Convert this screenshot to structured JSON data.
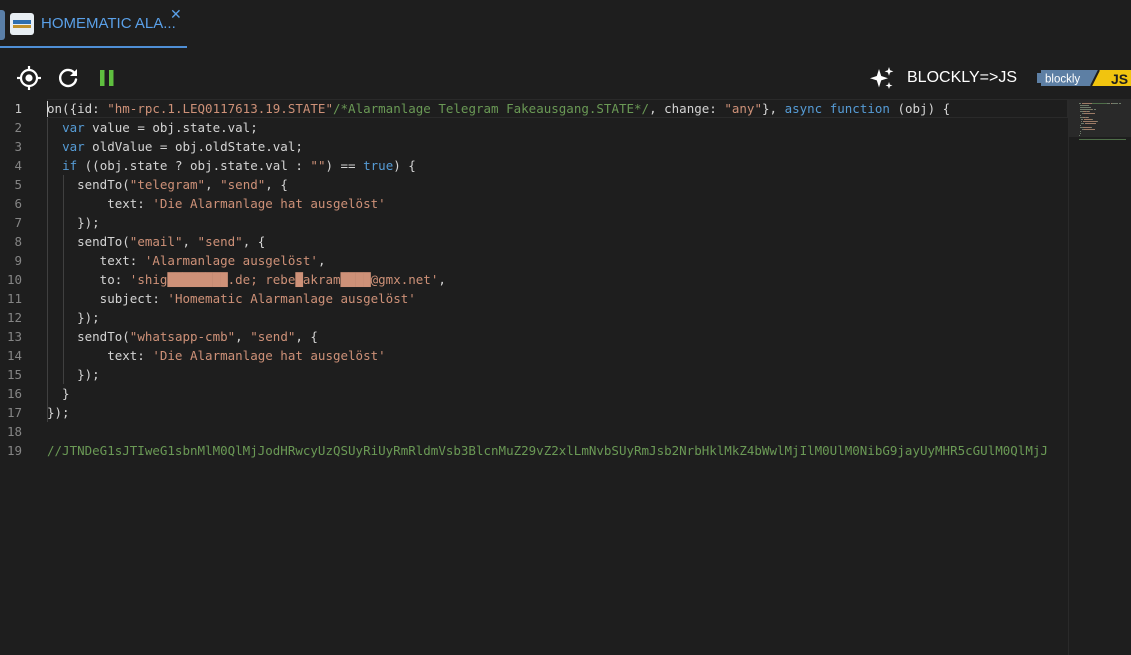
{
  "tab": {
    "label": "HOMEMATIC ALA...",
    "close_glyph": "✕",
    "icon": "homematic-script-icon"
  },
  "toolbar": {
    "locate_icon": "crosshair-icon",
    "reload_icon": "reload-icon",
    "pause_icon": "pause-icon",
    "convert_icon": "sparkle-icon",
    "convert_label": "BLOCKLY=>JS",
    "logo_blockly_text": "blockly",
    "logo_js_text": "JS"
  },
  "colors": {
    "keyword": "#569cd6",
    "string": "#ce9178",
    "comment": "#6a9955",
    "accent": "#4f8fd6",
    "pause": "#5fbf3f"
  },
  "editor": {
    "active_line": 1,
    "line_numbers": [
      "1",
      "2",
      "3",
      "4",
      "5",
      "6",
      "7",
      "8",
      "9",
      "10",
      "11",
      "12",
      "13",
      "14",
      "15",
      "16",
      "17",
      "18",
      "19"
    ],
    "lines": [
      [
        [
          "pl",
          "on({id: "
        ],
        [
          "str",
          "\"hm-rpc.1.LEQ0117613.19.STATE\""
        ],
        [
          "cm",
          "/*Alarmanlage Telegram Fakeausgang.STATE*/"
        ],
        [
          "pl",
          ", change: "
        ],
        [
          "str",
          "\"any\""
        ],
        [
          "pl",
          "}, "
        ],
        [
          "kw",
          "async"
        ],
        [
          "pl",
          " "
        ],
        [
          "kw",
          "function"
        ],
        [
          "pl",
          " (obj) {"
        ]
      ],
      [
        [
          "pl",
          "  "
        ],
        [
          "kw",
          "var"
        ],
        [
          "pl",
          " value = obj.state.val;"
        ]
      ],
      [
        [
          "pl",
          "  "
        ],
        [
          "kw",
          "var"
        ],
        [
          "pl",
          " oldValue = obj.oldState.val;"
        ]
      ],
      [
        [
          "pl",
          "  "
        ],
        [
          "kw",
          "if"
        ],
        [
          "pl",
          " ((obj.state ? obj.state.val : "
        ],
        [
          "str",
          "\"\""
        ],
        [
          "pl",
          ") == "
        ],
        [
          "kw",
          "true"
        ],
        [
          "pl",
          ") {"
        ]
      ],
      [
        [
          "pl",
          "    sendTo("
        ],
        [
          "str",
          "\"telegram\""
        ],
        [
          "pl",
          ", "
        ],
        [
          "str",
          "\"send\""
        ],
        [
          "pl",
          ", {"
        ]
      ],
      [
        [
          "pl",
          "        text: "
        ],
        [
          "str",
          "'Die Alarmanlage hat ausgelöst'"
        ]
      ],
      [
        [
          "pl",
          "    });"
        ]
      ],
      [
        [
          "pl",
          "    sendTo("
        ],
        [
          "str",
          "\"email\""
        ],
        [
          "pl",
          ", "
        ],
        [
          "str",
          "\"send\""
        ],
        [
          "pl",
          ", {"
        ]
      ],
      [
        [
          "pl",
          "       text: "
        ],
        [
          "str",
          "'Alarmanlage ausgelöst'"
        ],
        [
          "pl",
          ","
        ]
      ],
      [
        [
          "pl",
          "       to: "
        ],
        [
          "str",
          "'shig████████.de; rebe█akram████@gmx.net'"
        ],
        [
          "pl",
          ","
        ]
      ],
      [
        [
          "pl",
          "       subject: "
        ],
        [
          "str",
          "'Homematic Alarmanlage ausgelöst'"
        ]
      ],
      [
        [
          "pl",
          "    });"
        ]
      ],
      [
        [
          "pl",
          "    sendTo("
        ],
        [
          "str",
          "\"whatsapp-cmb\""
        ],
        [
          "pl",
          ", "
        ],
        [
          "str",
          "\"send\""
        ],
        [
          "pl",
          ", {"
        ]
      ],
      [
        [
          "pl",
          "        text: "
        ],
        [
          "str",
          "'Die Alarmanlage hat ausgelöst'"
        ]
      ],
      [
        [
          "pl",
          "    });"
        ]
      ],
      [
        [
          "pl",
          "  }"
        ]
      ],
      [
        [
          "pl",
          "});"
        ]
      ],
      [],
      [
        [
          "cm",
          "//JTNDeG1sJTIweG1sbnMlM0QlMjJodHRwcyUzQSUyRiUyRmRldmVsb3BlcnMuZ29vZ2xlLmNvbSUyRmJsb2NrbHklMkZ4bWwlMjIlM0UlM0NibG9jayUyMHR5cGUlM0QlMjJ"
        ]
      ]
    ]
  }
}
